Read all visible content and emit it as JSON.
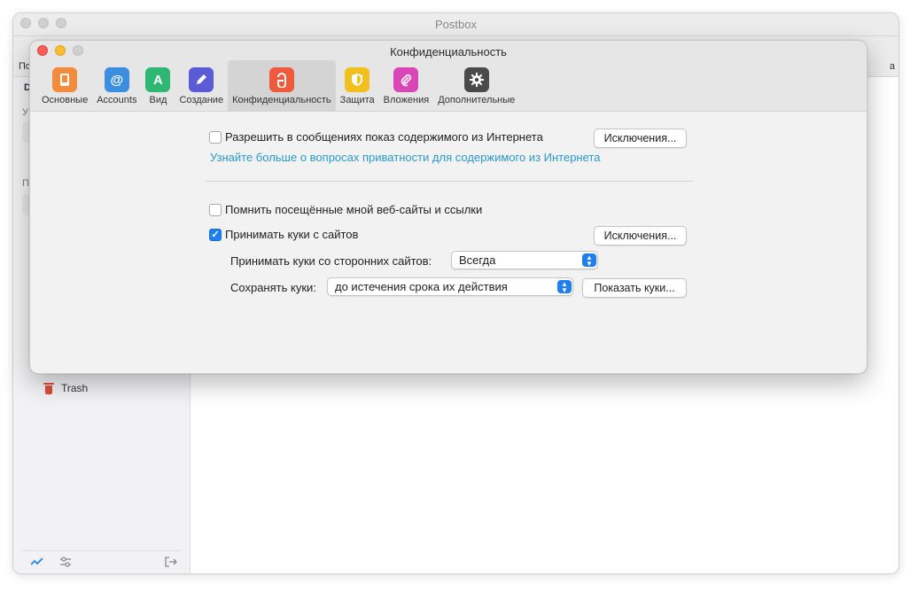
{
  "app_window": {
    "title": "Postbox",
    "toolbar_left_fragment": "По",
    "toolbar_right_fragment": "a",
    "sidebar_fragments": [
      "D",
      "У",
      "П"
    ],
    "trash_label": "Trash"
  },
  "dialog": {
    "title": "Конфиденциальность",
    "tabs": [
      {
        "label": "Основные",
        "icon": "phone-icon",
        "color": "#f08c3c"
      },
      {
        "label": "Accounts",
        "icon": "at-icon",
        "color": "#3c8ee0"
      },
      {
        "label": "Вид",
        "icon": "a-icon",
        "color": "#2fb873"
      },
      {
        "label": "Создание",
        "icon": "pencil-icon",
        "color": "#5b5bd6"
      },
      {
        "label": "Конфиденциальность",
        "icon": "privacy-icon",
        "color": "#f05a3c",
        "active": true
      },
      {
        "label": "Защита",
        "icon": "shield-icon",
        "color": "#f2c01e"
      },
      {
        "label": "Вложения",
        "icon": "paperclip-icon",
        "color": "#d946b8"
      },
      {
        "label": "Дополнительные",
        "icon": "gear-icon",
        "color": "#4a4a4a"
      }
    ],
    "remote_content": {
      "checkbox_label": "Разрешить в сообщениях показ содержимого из Интернета",
      "checked": false,
      "exceptions_button": "Исключения...",
      "learn_more_link": "Узнайте больше о вопросах приватности для содержимого из Интернета"
    },
    "history": {
      "checkbox_label": "Помнить посещённые мной веб-сайты и ссылки",
      "checked": false
    },
    "cookies": {
      "checkbox_label": "Принимать куки с сайтов",
      "checked": true,
      "exceptions_button": "Исключения...",
      "third_party_label": "Принимать куки со сторонних сайтов:",
      "third_party_value": "Всегда",
      "keep_label": "Сохранять куки:",
      "keep_value": "до истечения срока их действия",
      "show_cookies_button": "Показать куки..."
    },
    "check_glyph": "✓"
  }
}
